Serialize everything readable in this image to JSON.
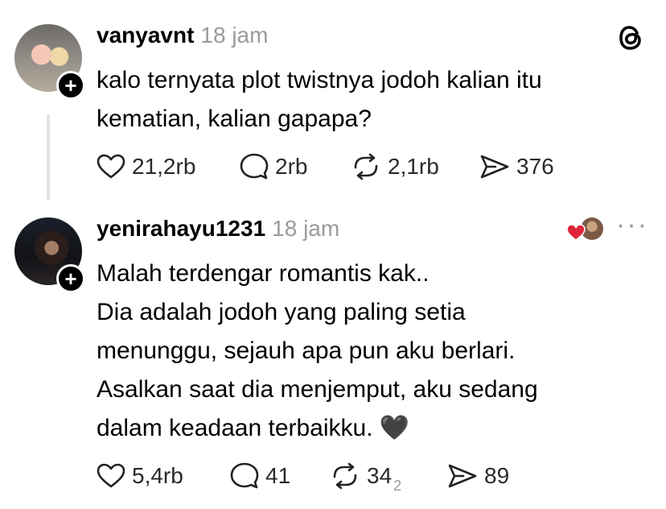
{
  "post": {
    "username": "vanyavnt",
    "time": "18 jam",
    "text_line1": "kalo ternyata plot twistnya jodoh kalian itu",
    "text_line2": "kematian, kalian gapapa?",
    "likes": "21,2rb",
    "replies": "2rb",
    "reposts": "2,1rb",
    "shares": "376"
  },
  "reply": {
    "username": "yenirahayu1231",
    "time": "18 jam",
    "lines": [
      "Malah terdengar romantis kak..",
      "Dia adalah jodoh yang paling setia",
      "menunggu, sejauh apa pun aku berlari.",
      "Asalkan saat dia menjemput, aku sedang",
      "dalam keadaan terbaikku. 🖤"
    ],
    "likes": "5,4rb",
    "replies": "41",
    "reposts": "34",
    "reposts_extra": "2",
    "shares": "89"
  },
  "icons": {
    "app": "threads-logo-icon",
    "like": "heart-icon",
    "reply": "comment-icon",
    "repost": "repost-icon",
    "share": "send-icon",
    "liked_by": "red-heart-icon",
    "more": "more-options-icon"
  },
  "colors": {
    "text": "#000000",
    "muted": "#9a9a9a",
    "liked_heart": "#e0243a"
  }
}
